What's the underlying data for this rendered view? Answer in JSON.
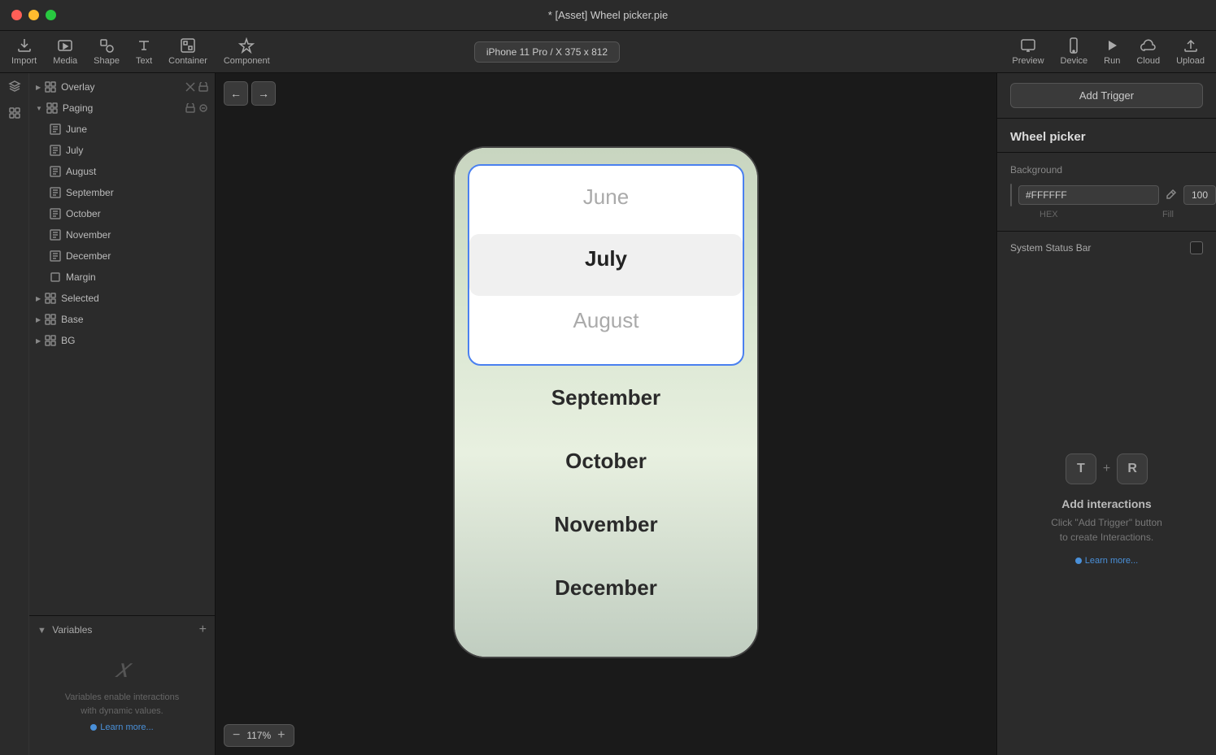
{
  "titlebar": {
    "title": "* [Asset] Wheel picker.pie"
  },
  "toolbar": {
    "import_label": "Import",
    "media_label": "Media",
    "shape_label": "Shape",
    "text_label": "Text",
    "container_label": "Container",
    "component_label": "Component",
    "device_selector": "iPhone 11 Pro / X  375 x 812",
    "preview_label": "Preview",
    "device_label": "Device",
    "run_label": "Run",
    "cloud_label": "Cloud",
    "upload_label": "Upload"
  },
  "sidebar": {
    "layers": [
      {
        "name": "Overlay",
        "indent": 0,
        "type": "group",
        "collapsed": true
      },
      {
        "name": "Paging",
        "indent": 0,
        "type": "group",
        "collapsed": false,
        "selected": false
      },
      {
        "name": "June",
        "indent": 1,
        "type": "item"
      },
      {
        "name": "July",
        "indent": 1,
        "type": "item"
      },
      {
        "name": "August",
        "indent": 1,
        "type": "item"
      },
      {
        "name": "September",
        "indent": 1,
        "type": "item"
      },
      {
        "name": "October",
        "indent": 1,
        "type": "item"
      },
      {
        "name": "November",
        "indent": 1,
        "type": "item"
      },
      {
        "name": "December",
        "indent": 1,
        "type": "item"
      },
      {
        "name": "Margin",
        "indent": 1,
        "type": "item"
      },
      {
        "name": "Selected",
        "indent": 0,
        "type": "group"
      },
      {
        "name": "Base",
        "indent": 0,
        "type": "group"
      },
      {
        "name": "BG",
        "indent": 0,
        "type": "group"
      }
    ],
    "variables_label": "Variables",
    "variables_desc": "Variables enable interactions\nwith dynamic values.",
    "learn_more": "Learn more...",
    "add_variables": "+"
  },
  "picker": {
    "months_above": [
      "June"
    ],
    "selected": "July",
    "months_below_window": [
      "August"
    ],
    "months_outside": [
      "September",
      "October",
      "November",
      "December"
    ]
  },
  "canvas": {
    "zoom": "117%",
    "zoom_minus": "−",
    "zoom_plus": "+"
  },
  "right_panel": {
    "title": "Wheel picker",
    "add_trigger": "Add Trigger",
    "bg_label": "Background",
    "bg_hex": "#FFFFFF",
    "bg_opacity": "100",
    "bg_hex_label": "HEX",
    "bg_fill_label": "Fill",
    "status_bar_label": "System Status Bar",
    "interactions_title": "Add interactions",
    "interactions_desc": "Click \"Add Trigger\" button\nto create Interactions.",
    "learn_more": "Learn more...",
    "key_t": "T",
    "key_r": "R",
    "plus": "+"
  }
}
